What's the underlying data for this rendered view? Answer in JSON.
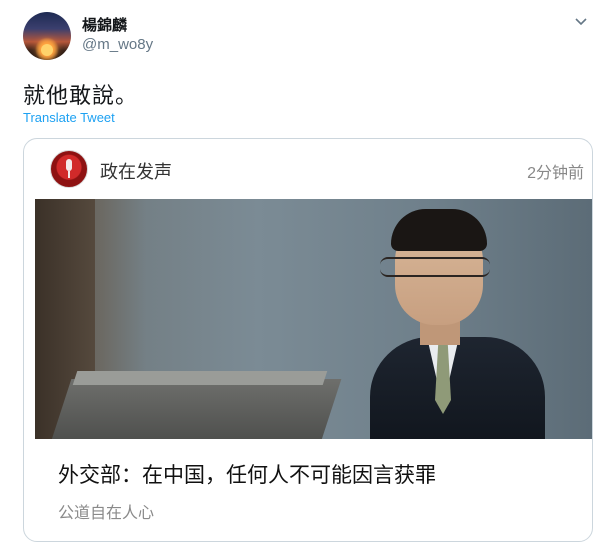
{
  "tweet": {
    "display_name": "楊錦麟",
    "handle": "@m_wo8y",
    "text": "就他敢說。",
    "translate_label": "Translate Tweet"
  },
  "card": {
    "source_name": "政在发声",
    "time": "2分钟前",
    "headline": "外交部：在中国，任何人不可能因言获罪",
    "subtitle": "公道自在人心"
  },
  "icons": {
    "menu": "chevron-down-icon",
    "source_logo": "microphone-icon"
  },
  "colors": {
    "link": "#1da1f2",
    "border": "#ccd6dd",
    "muted": "#657786"
  }
}
